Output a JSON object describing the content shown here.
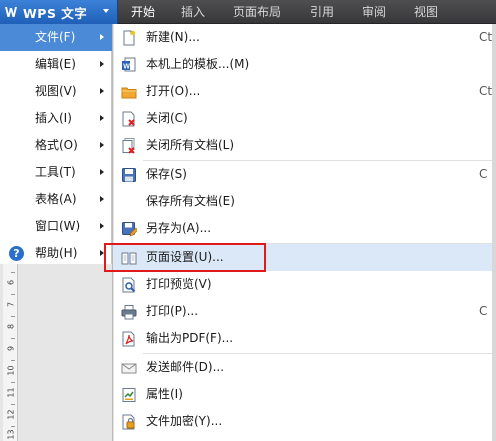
{
  "app": {
    "name": "WPS 文字",
    "logo_icon": "wps-w-logo-icon",
    "accent": "#2a6fcc"
  },
  "ribbon_tabs": [
    {
      "label": "开始",
      "active": true
    },
    {
      "label": "插入",
      "active": false
    },
    {
      "label": "页面布局",
      "active": false
    },
    {
      "label": "引用",
      "active": false
    },
    {
      "label": "审阅",
      "active": false
    },
    {
      "label": "视图",
      "active": false
    }
  ],
  "left_menu": {
    "items": [
      {
        "label": "文件(F)",
        "active": true
      },
      {
        "label": "编辑(E)",
        "active": false
      },
      {
        "label": "视图(V)",
        "active": false
      },
      {
        "label": "插入(I)",
        "active": false
      },
      {
        "label": "格式(O)",
        "active": false
      },
      {
        "label": "工具(T)",
        "active": false
      },
      {
        "label": "表格(A)",
        "active": false
      },
      {
        "label": "窗口(W)",
        "active": false
      },
      {
        "label": "帮助(H)",
        "active": false,
        "icon": "help-icon"
      }
    ]
  },
  "ruler": {
    "numbers": [
      "6",
      "7",
      "8",
      "9",
      "10",
      "11",
      "12",
      "13"
    ]
  },
  "file_menu": {
    "items": [
      {
        "label": "新建(N)...",
        "icon": "new-document-icon",
        "shortcut": "Ct"
      },
      {
        "label": "本机上的模板...(M)",
        "icon": "template-icon"
      },
      {
        "label": "打开(O)...",
        "icon": "open-folder-icon",
        "shortcut": "Ct"
      },
      {
        "label": "关闭(C)",
        "icon": "close-document-icon"
      },
      {
        "label": "关闭所有文档(L)",
        "icon": "close-all-documents-icon"
      },
      {
        "label": "保存(S)",
        "icon": "save-icon",
        "shortcut": "C"
      },
      {
        "label": "保存所有文档(E)",
        "icon": ""
      },
      {
        "label": "另存为(A)...",
        "icon": "save-as-icon"
      },
      {
        "label": "页面设置(U)...",
        "icon": "page-setup-icon",
        "highlighted": true
      },
      {
        "label": "打印预览(V)",
        "icon": "print-preview-icon"
      },
      {
        "label": "打印(P)...",
        "icon": "printer-icon",
        "shortcut": "C"
      },
      {
        "label": "输出为PDF(F)...",
        "icon": "pdf-export-icon"
      },
      {
        "label": "发送邮件(D)...",
        "icon": "send-mail-icon"
      },
      {
        "label": "属性(I)",
        "icon": "properties-icon"
      },
      {
        "label": "文件加密(Y)...",
        "icon": "encrypt-file-icon"
      }
    ]
  }
}
